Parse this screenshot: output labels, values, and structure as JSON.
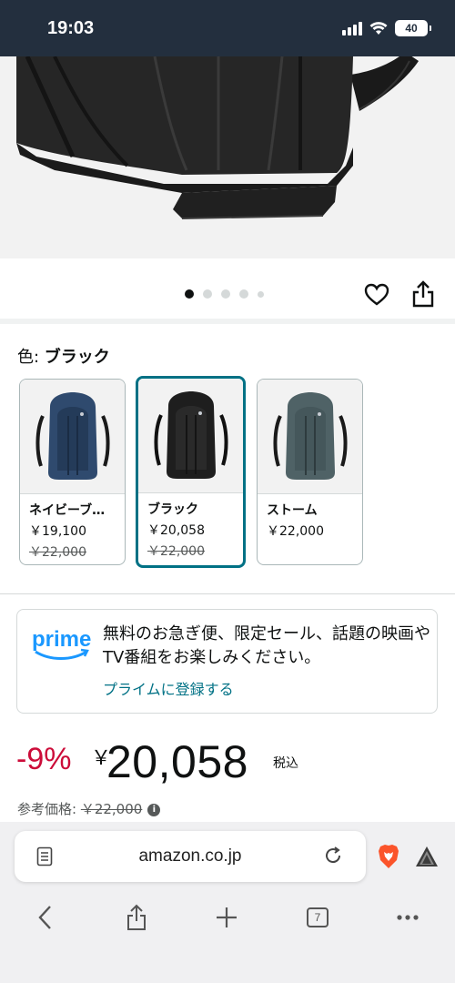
{
  "status_bar": {
    "time": "19:03",
    "battery": "40"
  },
  "carousel": {
    "image_count": 5,
    "active_index": 0
  },
  "color_selector": {
    "label_prefix": "色: ",
    "selected_color": "ブラック",
    "options": [
      {
        "name": "ネイビーブ…",
        "price": "￥19,100",
        "was_price": "￥22,000",
        "color": "#2f4a6e"
      },
      {
        "name": "ブラック",
        "price": "￥20,058",
        "was_price": "￥22,000",
        "color": "#1e1e1e"
      },
      {
        "name": "ストーム",
        "price": "￥22,000",
        "color": "#4f6266"
      }
    ]
  },
  "prime": {
    "logo_text": "prime",
    "message": "無料のお急ぎ便、限定セール、話題の映画やTV番組をお楽しみください。",
    "link": "プライムに登録する"
  },
  "pricing": {
    "discount": "-9%",
    "currency": "￥",
    "price": "20,058",
    "tax_label": "税込",
    "ref_label": "参考価格: ",
    "ref_price": "￥22,000"
  },
  "browser": {
    "url": "amazon.co.jp",
    "tab_count": "7"
  },
  "colors": {
    "header_bg": "#232f3e",
    "selected_border": "#007185",
    "discount_red": "#cc0c39",
    "link_teal": "#007185",
    "prime_blue": "#1a98ff"
  }
}
